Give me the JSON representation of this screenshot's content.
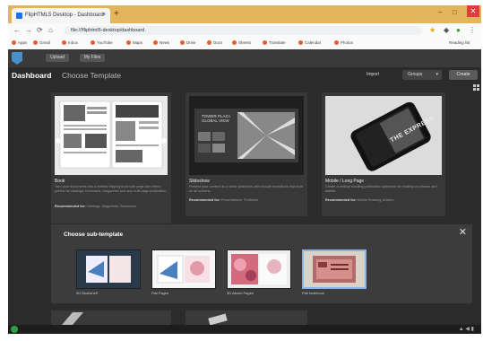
{
  "browser": {
    "tab_title": "FlipHTML5 Desktop - Dashboard",
    "tab_close": "×",
    "new_tab": "+",
    "url": "file:///fliphtml5-desktop/dashboard",
    "nav": {
      "back": "←",
      "forward": "→",
      "reload": "⟳",
      "home": "⌂"
    },
    "window_controls": {
      "minimize": "–",
      "maximize": "□",
      "close": "✕"
    },
    "bookmarks": [
      "Apps",
      "Gmail",
      "Inbox",
      "YouTube",
      "Maps",
      "News",
      "Drive",
      "Docs",
      "Sheets",
      "Translate",
      "Calendar",
      "Photos"
    ],
    "reading_list": "Reading list"
  },
  "app": {
    "header_buttons": [
      "Upload",
      "My Files"
    ],
    "breadcrumb_dashboard": "Dashboard",
    "breadcrumb_current": "Choose Template",
    "import_label": "Import",
    "select_value": "Groups",
    "select_caret": "▾",
    "create_button": "Create"
  },
  "templates": [
    {
      "title": "Book",
      "desc": "Turn your documents into a realistic flipping book with page-turn effect, perfect for catalogs, brochures, magazines and any multi-page publication.",
      "rec_label": "Recommended for:",
      "rec": "Catalogs, Magazines, Brochures"
    },
    {
      "title": "Slideshow",
      "desc": "Present your content as a sleek slideshow with smooth transitions that work on all screens.",
      "rec_label": "Recommended for:",
      "rec": "Presentations, Portfolios"
    },
    {
      "title": "Mobile / Long Page",
      "desc": "Create a vertical scrolling publication optimized for reading on phones and tablets.",
      "rec_label": "Recommended for:",
      "rec": "Mobile Reading, Articles"
    }
  ],
  "thumb_text": {
    "slideshow": "TOWER PLAZA GLOBAL VIEW",
    "mobile": "THE EXPRESS"
  },
  "sub_panel": {
    "title": "Choose sub-template",
    "close": "✕",
    "items": [
      "3D Bookshelf",
      "Flat Pages",
      "3D Album Pages",
      "Flat Notebook"
    ]
  },
  "colors": {
    "accent": "#4a90c8",
    "tabbar": "#e3b65c",
    "bg": "#2b2b2b"
  }
}
